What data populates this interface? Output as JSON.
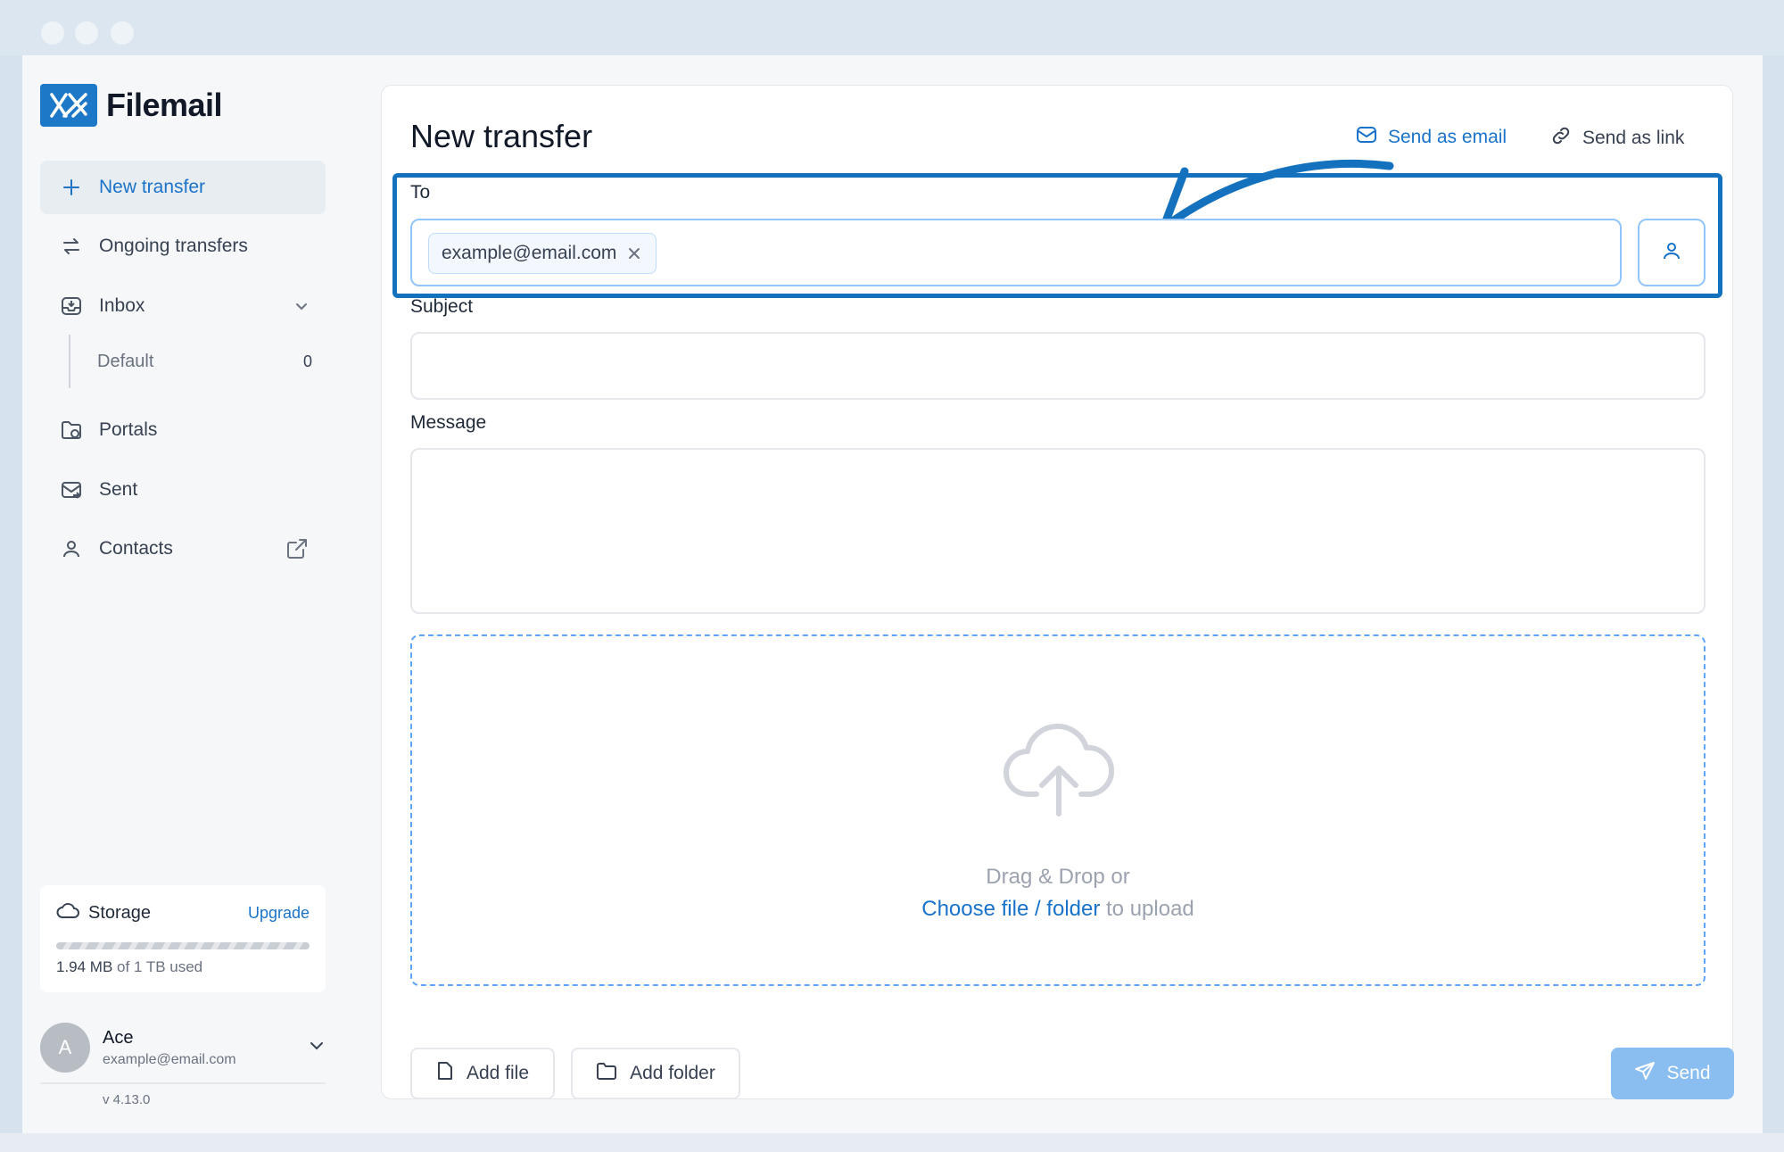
{
  "app": {
    "name": "Filemail",
    "brand_color": "#1e78c8",
    "accent_color": "#1a73c9"
  },
  "sidebar": {
    "items": [
      {
        "label": "New transfer",
        "icon": "plus-icon",
        "active": true
      },
      {
        "label": "Ongoing transfers",
        "icon": "transfer-arrows-icon"
      },
      {
        "label": "Inbox",
        "icon": "inbox-icon"
      },
      {
        "label": "Portals",
        "icon": "portal-icon"
      },
      {
        "label": "Sent",
        "icon": "sent-mail-icon"
      },
      {
        "label": "Contacts",
        "icon": "user-icon"
      }
    ],
    "inbox_sub": {
      "label": "Default",
      "count": "0"
    },
    "storage": {
      "title": "Storage",
      "upgrade_label": "Upgrade",
      "used": "1.94 MB",
      "of_text": "of 1 TB used"
    },
    "user": {
      "initial": "A",
      "name": "Ace",
      "email": "example@email.com"
    },
    "version": "v 4.13.0"
  },
  "main": {
    "title": "New transfer",
    "send_as_email": "Send as email",
    "send_as_link": "Send as link",
    "to_label": "To",
    "recipients": [
      "example@email.com"
    ],
    "subject_label": "Subject",
    "subject_value": "",
    "message_label": "Message",
    "message_value": "",
    "dropzone": {
      "line1": "Drag & Drop or",
      "link": "Choose file / folder",
      "suffix": " to upload"
    },
    "add_file_label": "Add file",
    "add_folder_label": "Add folder",
    "send_label": "Send"
  }
}
